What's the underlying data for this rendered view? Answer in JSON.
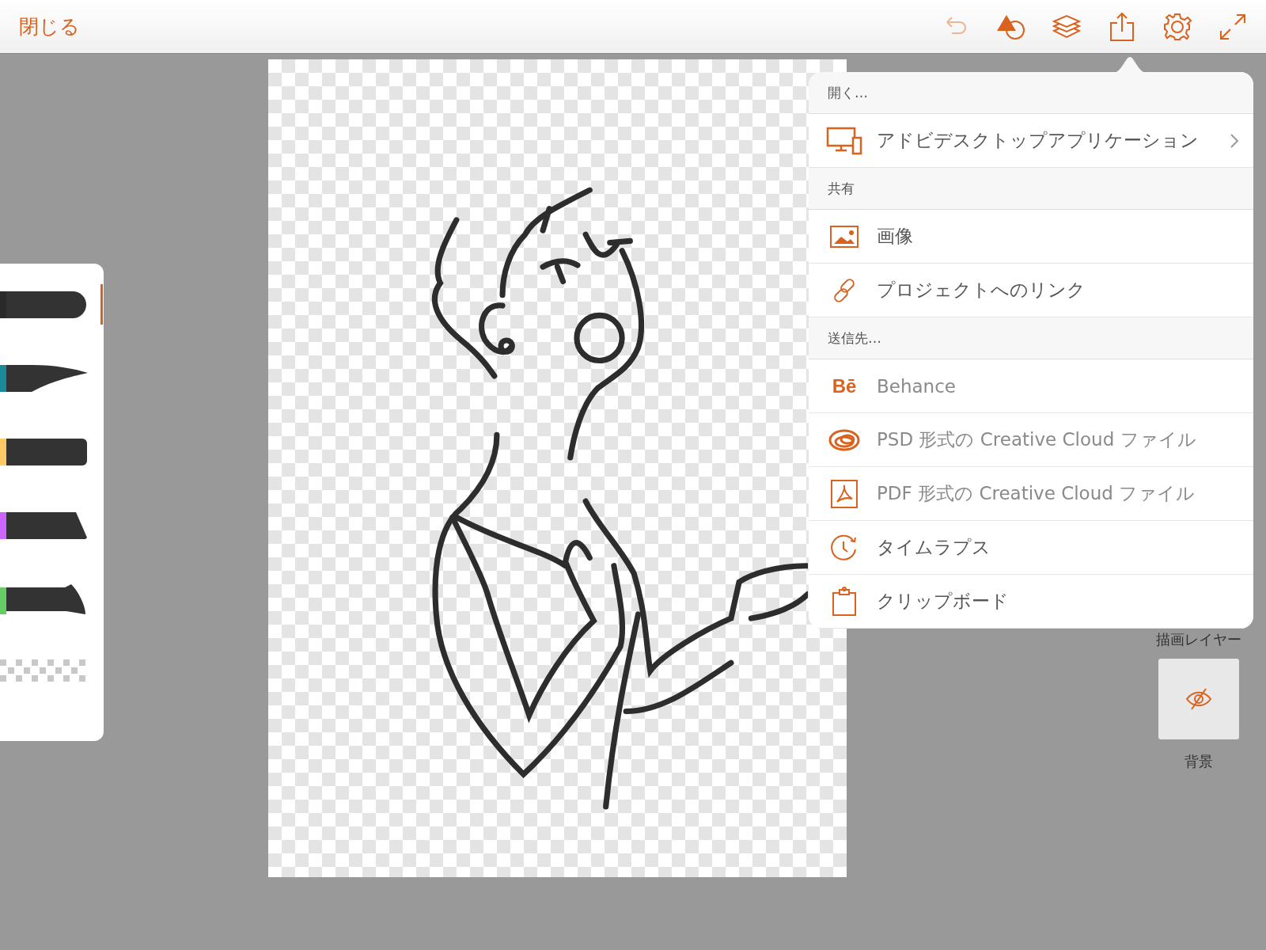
{
  "top_bar": {
    "close": "閉じる",
    "tools": [
      {
        "kind": "undo",
        "disabled": true
      },
      {
        "kind": "shapes",
        "disabled": false
      },
      {
        "kind": "layers",
        "disabled": false
      },
      {
        "kind": "share",
        "disabled": false
      },
      {
        "kind": "settings",
        "disabled": false
      },
      {
        "kind": "expand",
        "disabled": false
      }
    ]
  },
  "brushes": [
    {
      "kind": "round",
      "color": "#2a2a2a",
      "selected": true
    },
    {
      "kind": "taper",
      "color": "#1a8a99",
      "selected": false
    },
    {
      "kind": "flat",
      "color": "#ffc966",
      "selected": false
    },
    {
      "kind": "chisel",
      "color": "#cc66ff",
      "selected": false
    },
    {
      "kind": "knife",
      "color": "#66cc66",
      "selected": false
    },
    {
      "kind": "eraser",
      "selected": false
    }
  ],
  "share_menu": {
    "sections": [
      {
        "header": "開く…",
        "items": [
          {
            "kind": "devices",
            "label": "アドビデスクトップアプリケーション",
            "has_submenu": true,
            "disabled": false
          }
        ]
      },
      {
        "header": "共有",
        "items": [
          {
            "kind": "image",
            "label": "画像",
            "has_submenu": false,
            "disabled": false
          },
          {
            "kind": "link",
            "label": "プロジェクトへのリンク",
            "has_submenu": false,
            "disabled": false
          }
        ]
      },
      {
        "header": "送信先…",
        "items": [
          {
            "kind": "logo",
            "logo_text": "Bē",
            "label": "Behance",
            "has_submenu": false,
            "disabled": true
          },
          {
            "kind": "cloud",
            "label": "PSD 形式の Creative Cloud ファイル",
            "has_submenu": false,
            "disabled": true
          },
          {
            "kind": "pdf",
            "label": "PDF 形式の Creative Cloud ファイル",
            "has_submenu": false,
            "disabled": true
          },
          {
            "kind": "timelapse",
            "label": "タイムラプス",
            "has_submenu": false,
            "disabled": false
          },
          {
            "kind": "clipboard",
            "label": "クリップボード",
            "has_submenu": false,
            "disabled": false
          }
        ]
      }
    ]
  },
  "layers": [
    {
      "label": "描画レイヤー"
    },
    {
      "label": "背景",
      "visible": false
    }
  ]
}
